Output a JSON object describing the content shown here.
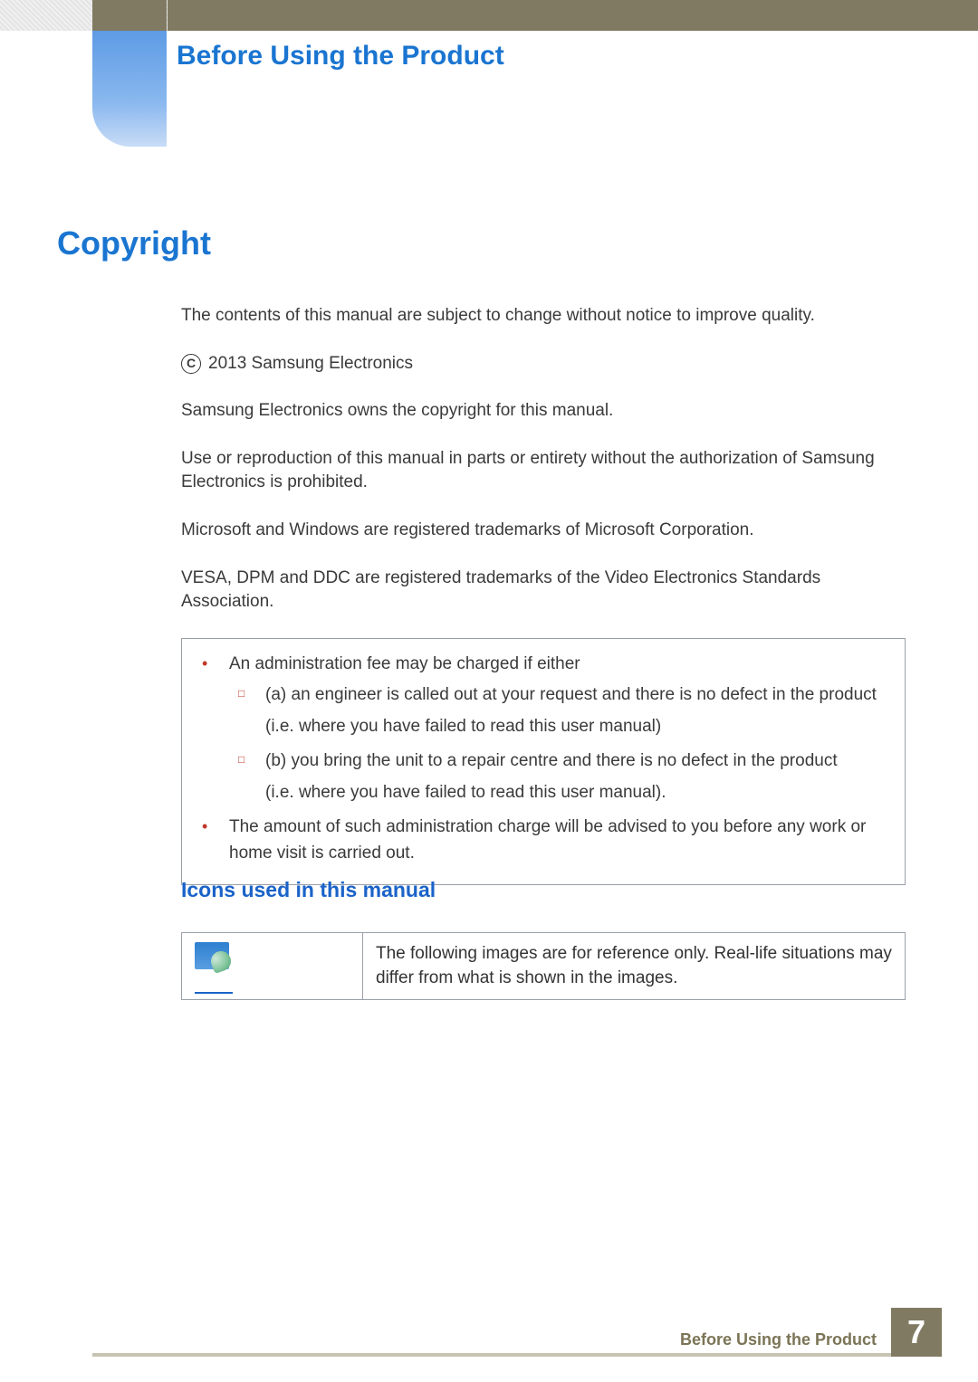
{
  "header": {
    "chapter_title": "Before Using the Product"
  },
  "section": {
    "title": "Copyright"
  },
  "body": {
    "p1": "The contents of this manual are subject to change without notice to improve quality.",
    "copyright_mark": "C",
    "copyright_year": "2013 Samsung Electronics",
    "p2": "Samsung Electronics owns the copyright for this manual.",
    "p3": "Use or reproduction of this manual in parts or entirety without the authorization of Samsung Electronics is prohibited.",
    "p4": "Microsoft and Windows are registered trademarks of Microsoft Corporation.",
    "p5": "VESA, DPM and DDC are registered trademarks of the Video Electronics Standards Association."
  },
  "notice": {
    "b1": "An administration fee may be charged if either",
    "s1a": "(a) an engineer is called out at your request and there is no defect in the product",
    "s1a_note": "(i.e. where you have failed to read this user manual)",
    "s1b": "(b) you bring the unit to a repair centre and there is no defect in the product",
    "s1b_note": "(i.e. where you have failed to read this user manual).",
    "b2": "The amount of such administration charge will be advised to you before any work or home visit is carried out."
  },
  "subsection": {
    "title": "Icons used in this manual",
    "icon_desc": "The following images are for reference only. Real-life situations may differ from what is shown in the images."
  },
  "footer": {
    "label": "Before Using the Product",
    "page": "7"
  }
}
